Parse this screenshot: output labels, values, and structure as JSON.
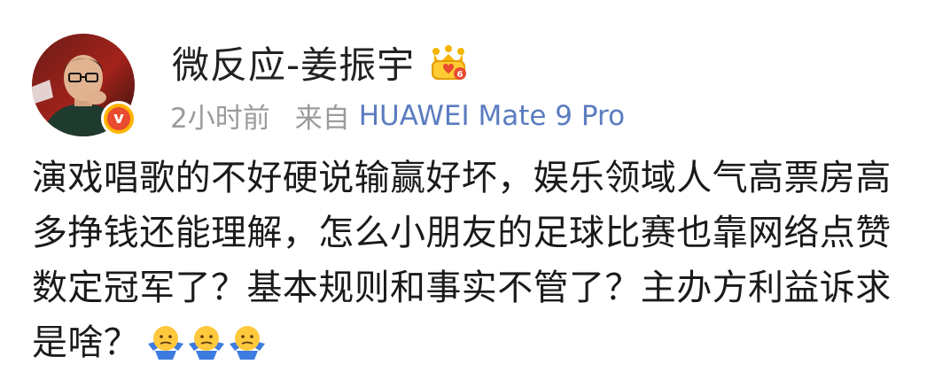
{
  "post": {
    "username": "微反应-姜振宇",
    "time": "2小时前",
    "source_prefix": "来自",
    "source_device": "HUAWEI Mate 9 Pro",
    "verified_mark": "v",
    "level_badge_number": "6",
    "content": "演戏唱歌的不好硬说输赢好坏，娱乐领域人气高票房高多挣钱还能理解，怎么小朋友的足球比赛也靠网络点赞数定冠军了？基本规则和事实不管了？主办方利益诉求是啥？",
    "emojis": [
      "shrug-icon",
      "shrug-icon",
      "shrug-icon"
    ]
  },
  "colors": {
    "username": "#222222",
    "meta": "#9b9b9b",
    "device_link": "#5b7cc0",
    "badge_yellow": "#ffb400",
    "badge_red": "#e84b2f"
  }
}
